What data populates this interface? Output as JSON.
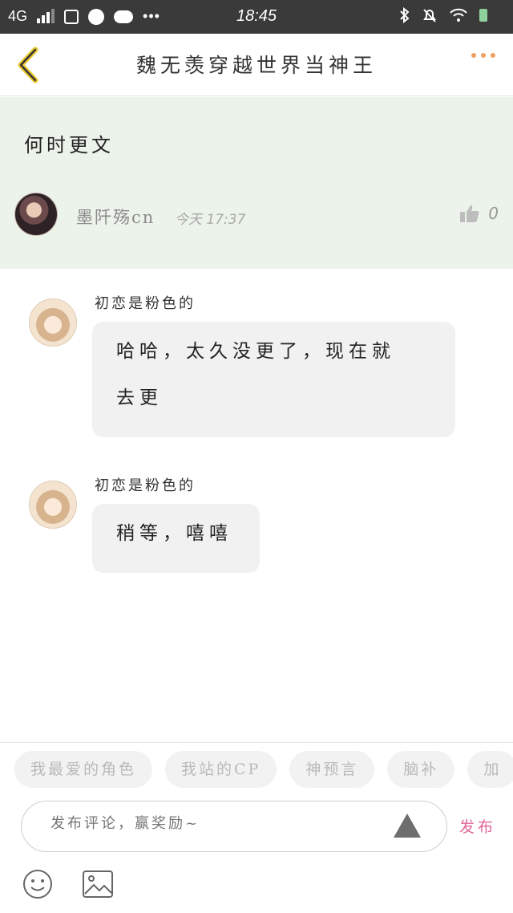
{
  "status_bar": {
    "network": "4G",
    "time": "18:45",
    "left_icons": [
      "signal-icon",
      "database-icon",
      "ball-icon",
      "cloud-icon",
      "more-dots-icon"
    ],
    "right_icons": [
      "bluetooth-icon",
      "mute-icon",
      "wifi-icon",
      "battery-icon"
    ]
  },
  "header": {
    "title": "魏无羡穿越世界当神王",
    "back_icon": "chevron-left-icon",
    "more_icon": "more-dots-icon",
    "accent_color": "#f0a060"
  },
  "topic": {
    "text": "何时更文",
    "author": "墨阡殇cn",
    "time": "今天 17:37",
    "likes": "0",
    "background": "#ecf3ea"
  },
  "replies": [
    {
      "author": "初恋是粉色的",
      "lines": [
        "哈哈，太久没更了，现在就",
        "去更"
      ]
    },
    {
      "author": "初恋是粉色的",
      "lines": [
        "稍等，嘻嘻"
      ]
    }
  ],
  "tags": [
    "我最爱的角色",
    "我站的CP",
    "神预言",
    "脑补",
    "加"
  ],
  "composer": {
    "placeholder": "发布评论，赢奖励~",
    "publish_label": "发布",
    "publish_color": "#e0679a",
    "tool_icons": [
      "emoji-icon",
      "image-icon"
    ]
  }
}
